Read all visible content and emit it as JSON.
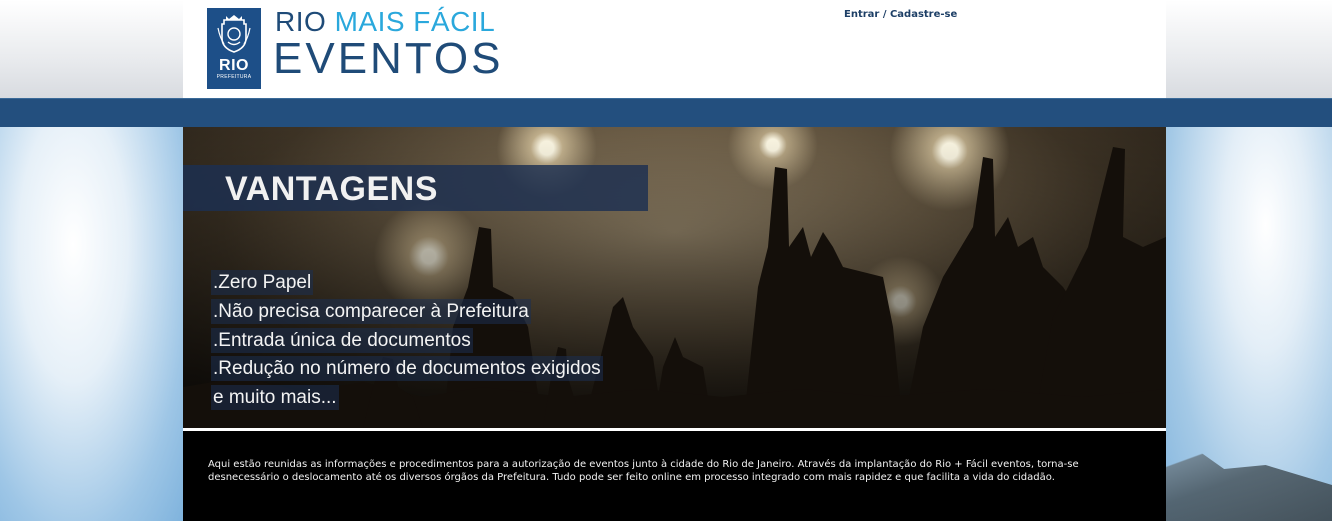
{
  "header": {
    "logo": {
      "text": "RIO",
      "subtext": "PREFEITURA"
    },
    "brand": {
      "line1_prefix": "RIO",
      "line1_highlight": "MAIS FÁCIL",
      "line2": "EVENTOS"
    },
    "login_link": "Entrar / Cadastre-se"
  },
  "banner": {
    "title": "VANTAGENS",
    "benefits": [
      ".Zero Papel",
      ".Não precisa comparecer à Prefeitura",
      ".Entrada única de documentos",
      ".Redução no número de documentos exigidos",
      "e muito mais..."
    ]
  },
  "info": {
    "text": "Aqui estão reunidas as informações e procedimentos para a autorização de eventos junto à cidade do Rio de Janeiro. Através da implantação do Rio + Fácil eventos, torna-se desnecessário o deslocamento até os diversos órgãos da Prefeitura. Tudo pode ser feito online em processo integrado com mais rapidez e que facilita a vida do cidadão."
  },
  "colors": {
    "nav_bar": "#234f7e",
    "logo_bg": "#1d4f88",
    "brand_dark": "#1f4b78",
    "brand_light": "#2aa8dc",
    "info_bg": "#000000"
  }
}
